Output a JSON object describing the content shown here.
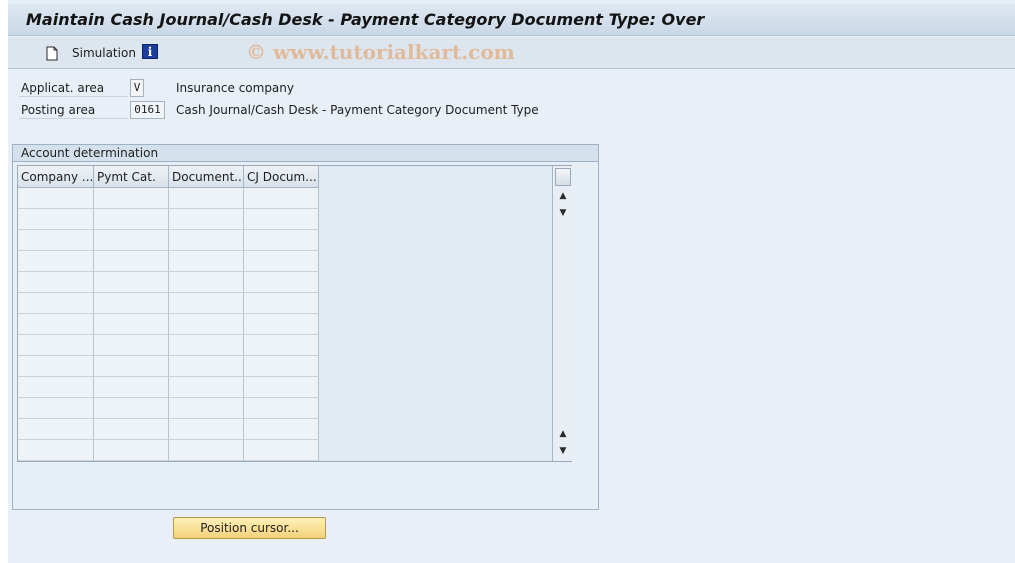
{
  "window": {
    "title": "Maintain Cash Journal/Cash Desk - Payment Category Document Type: Over"
  },
  "toolbar": {
    "simulation_label": "Simulation",
    "watermark": "© www.tutorialkart.com"
  },
  "fields": {
    "applicat_area": {
      "label": "Applicat. area",
      "value": "V",
      "description": "Insurance company"
    },
    "posting_area": {
      "label": "Posting area",
      "value": "0161",
      "description": "Cash Journal/Cash Desk - Payment Category Document Type"
    }
  },
  "account_determination": {
    "title": "Account determination",
    "columns": [
      "Company ...",
      "Pymt Cat.",
      "Document...",
      "CJ Docum..."
    ]
  },
  "buttons": {
    "position_cursor": "Position cursor..."
  },
  "icons": {
    "new_document": "document-icon",
    "info": "info-icon",
    "scroll_up": "triangle-up-icon",
    "scroll_down": "triangle-down-icon"
  }
}
